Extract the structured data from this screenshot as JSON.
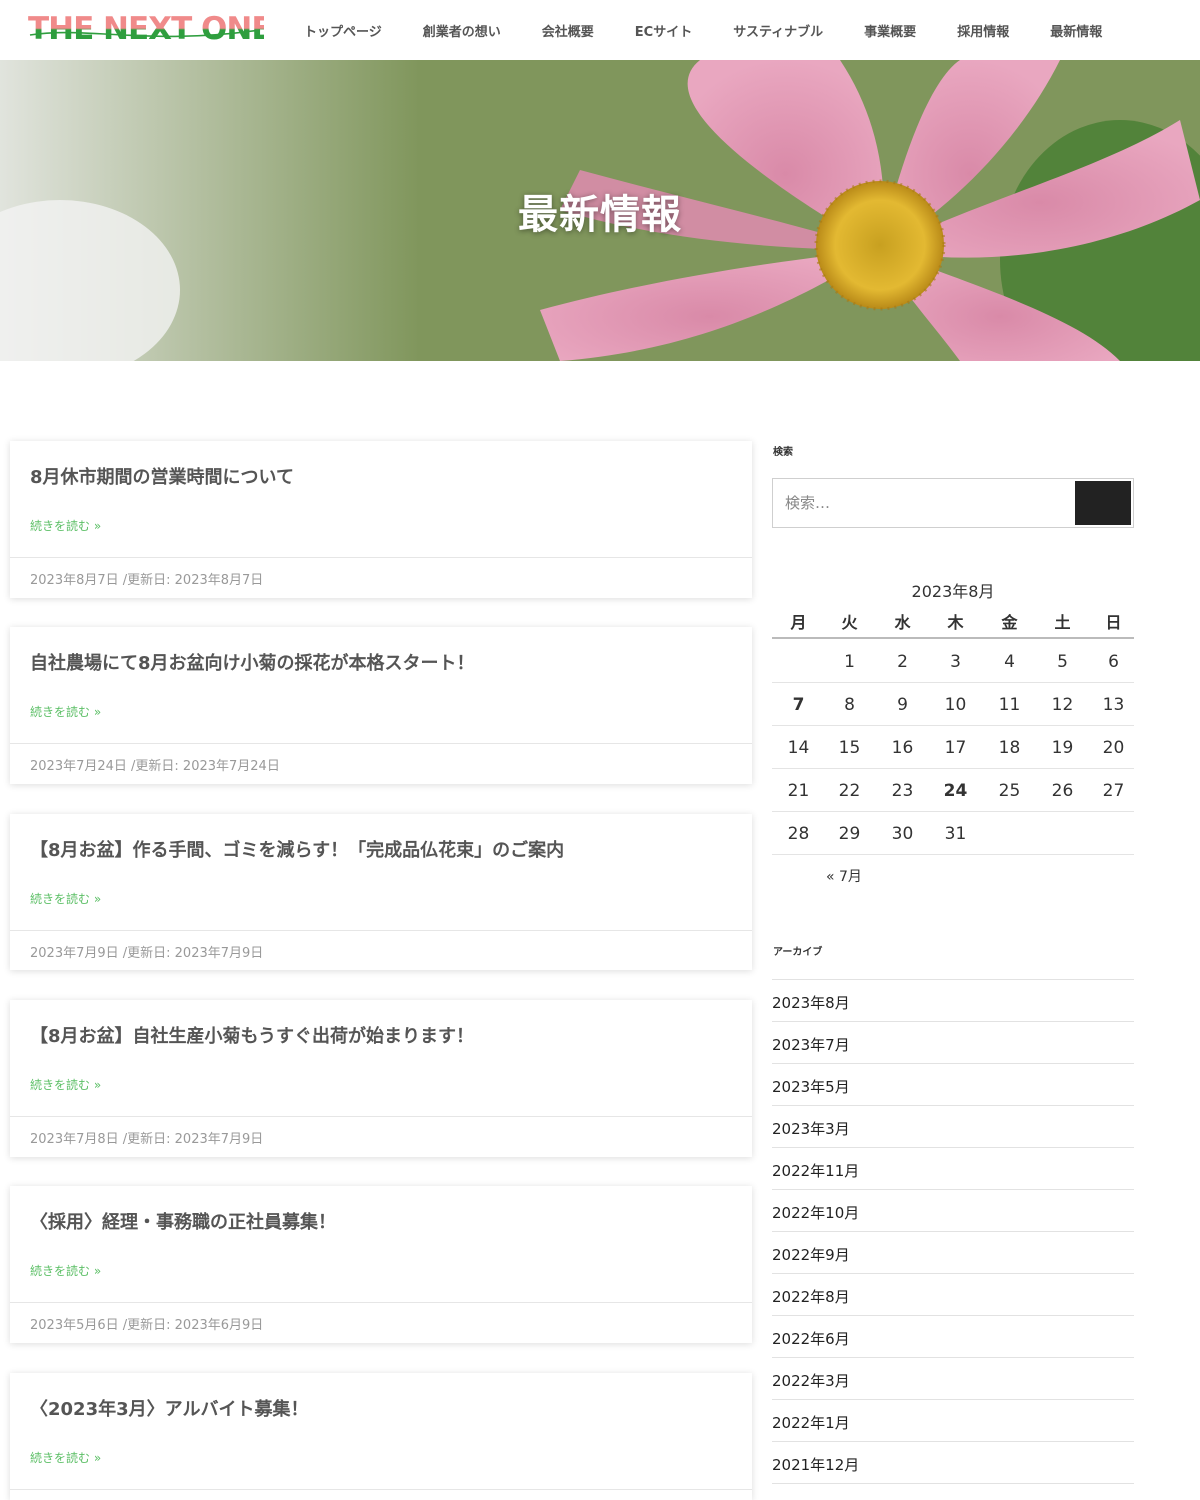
{
  "header": {
    "logo_text": "THE NEXT ONE",
    "nav": [
      "トップページ",
      "創業者の想い",
      "会社概要",
      "ECサイト",
      "サスティナブル",
      "事業概要",
      "採用情報",
      "最新情報"
    ]
  },
  "hero": {
    "title": "最新情報"
  },
  "posts": [
    {
      "title": "8月休市期間の営業時間について",
      "more": "続きを読む »",
      "meta": "2023年8月7日 /更新日: 2023年8月7日"
    },
    {
      "title": "自社農場にて8月お盆向け小菊の採花が本格スタート！",
      "more": "続きを読む »",
      "meta": "2023年7月24日 /更新日: 2023年7月24日"
    },
    {
      "title": "【8月お盆】作る手間、ゴミを減らす！「完成品仏花束」のご案内",
      "more": "続きを読む »",
      "meta": "2023年7月9日 /更新日: 2023年7月9日"
    },
    {
      "title": "【8月お盆】自社生産小菊もうすぐ出荷が始まります！",
      "more": "続きを読む »",
      "meta": "2023年7月8日 /更新日: 2023年7月9日"
    },
    {
      "title": "〈採用〉経理・事務職の正社員募集！",
      "more": "続きを読む »",
      "meta": "2023年5月6日 /更新日: 2023年6月9日"
    },
    {
      "title": "〈2023年3月〉アルバイト募集！",
      "more": "続きを読む »",
      "meta": ""
    }
  ],
  "sidebar": {
    "search_title": "検索",
    "search_placeholder": "検索…",
    "calendar": {
      "caption": "2023年8月",
      "weekdays": [
        "月",
        "火",
        "水",
        "木",
        "金",
        "土",
        "日"
      ],
      "weeks": [
        [
          "",
          "1",
          "2",
          "3",
          "4",
          "5",
          "6"
        ],
        [
          "7",
          "8",
          "9",
          "10",
          "11",
          "12",
          "13"
        ],
        [
          "14",
          "15",
          "16",
          "17",
          "18",
          "19",
          "20"
        ],
        [
          "21",
          "22",
          "23",
          "24",
          "25",
          "26",
          "27"
        ],
        [
          "28",
          "29",
          "30",
          "31",
          "",
          "",
          ""
        ]
      ],
      "prev": "« 7月"
    },
    "archive_title": "アーカイブ",
    "archives": [
      "2023年8月",
      "2023年7月",
      "2023年5月",
      "2023年3月",
      "2022年11月",
      "2022年10月",
      "2022年9月",
      "2022年8月",
      "2022年6月",
      "2022年3月",
      "2022年1月",
      "2021年12月"
    ]
  },
  "colors": {
    "accent_green": "#5cbf66",
    "logo_pink": "#f08a8a",
    "logo_green": "#2e9e3e",
    "search_button": "#222222"
  }
}
